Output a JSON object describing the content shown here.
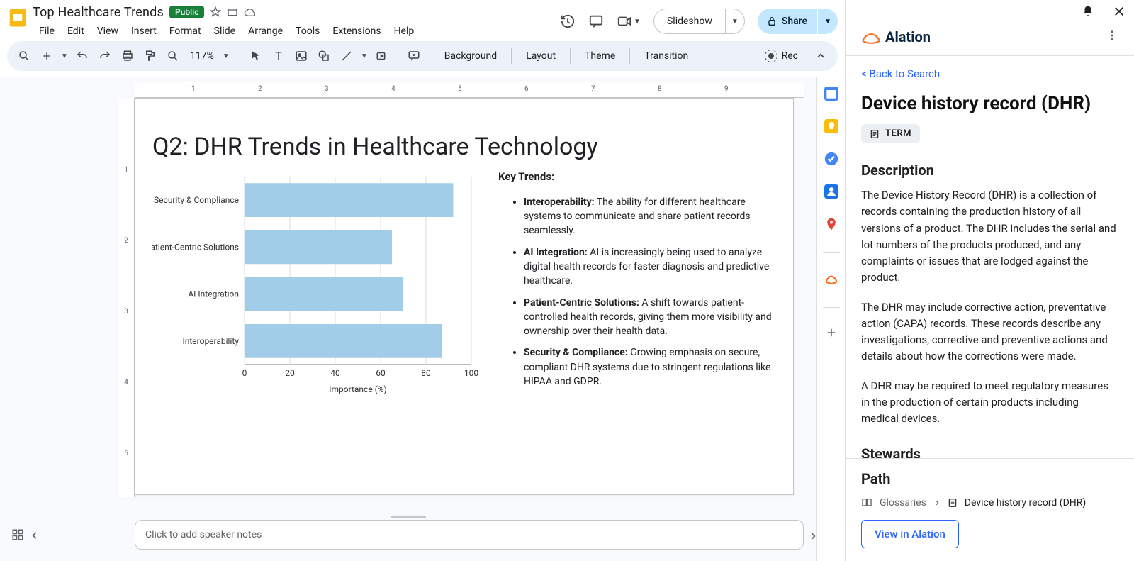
{
  "doc": {
    "title": "Top Healthcare Trends",
    "badge": "Public"
  },
  "menus": [
    "File",
    "Edit",
    "View",
    "Insert",
    "Format",
    "Slide",
    "Arrange",
    "Tools",
    "Extensions",
    "Help"
  ],
  "buttons": {
    "slideshow": "Slideshow",
    "share": "Share",
    "rec": "Rec"
  },
  "zoom": "117%",
  "tb_labels": {
    "background": "Background",
    "layout": "Layout",
    "theme": "Theme",
    "transition": "Transition"
  },
  "slide": {
    "title": "Q2: DHR Trends in Healthcare Technology",
    "key_trends_heading": "Key Trends:",
    "bullets": [
      {
        "term": "Interoperability:",
        "text": " The ability for different healthcare systems to communicate and share patient records seamlessly."
      },
      {
        "term": "AI Integration:",
        "text": " AI is increasingly being used to analyze digital health records for faster diagnosis and predictive healthcare."
      },
      {
        "term": "Patient-Centric Solutions:",
        "text": " A shift towards patient-controlled health records, giving them more visibility and ownership over their health data."
      },
      {
        "term": "Security & Compliance:",
        "text": " Growing emphasis on secure, compliant DHR systems due to stringent regulations like HIPAA and GDPR."
      }
    ]
  },
  "chart_data": {
    "type": "bar",
    "orientation": "horizontal",
    "categories": [
      "Security & Compliance",
      "Patient-Centric Solutions",
      "AI Integration",
      "Interoperability"
    ],
    "values": [
      92,
      65,
      70,
      87
    ],
    "xlabel": "Importance (%)",
    "xlim": [
      0,
      100
    ],
    "xticks": [
      0,
      20,
      40,
      60,
      80,
      100
    ],
    "bar_color": "#a1cde8"
  },
  "notes_placeholder": "Click to add speaker notes",
  "ruler": {
    "h": [
      1,
      2,
      3,
      4,
      5,
      6,
      7,
      8,
      9
    ],
    "v": [
      1,
      2,
      3,
      4,
      5
    ]
  },
  "panel": {
    "brand": "Alation",
    "back": "< Back to Search",
    "title": "Device history record (DHR)",
    "chip": "TERM",
    "desc_title": "Description",
    "paras": [
      "The Device History Record (DHR) is a collection of records containing the production history of all versions of a product. The DHR includes the serial and lot numbers of the products produced, and any complaints or issues that are lodged against the product.",
      "The DHR may include corrective action, preventative action (CAPA) records. These records describe any investigations, corrective and preventive actions and details about how the corrections were made.",
      "A DHR may be required to meet regulatory measures in the production of certain products including medical devices."
    ],
    "stewards_title": "Stewards",
    "path_title": "Path",
    "path": [
      "Glossaries",
      "Device history record (DHR)"
    ],
    "view_btn": "View in Alation"
  }
}
